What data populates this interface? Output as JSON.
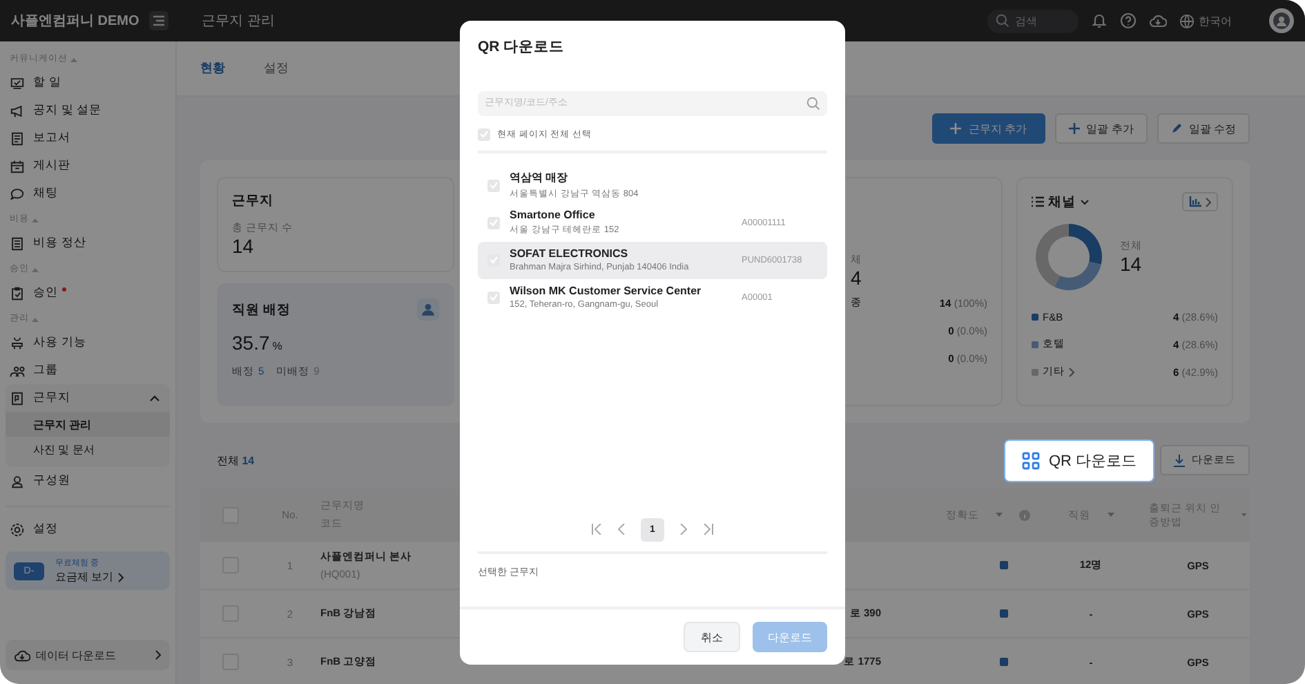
{
  "topbar": {
    "brand": "사플엔컴퍼니 DEMO",
    "page_title": "근무지 관리",
    "search": {
      "placeholder": "검색"
    },
    "language": "한국어"
  },
  "sidebar": {
    "sections": [
      {
        "label": "커뮤니케이션",
        "items": [
          {
            "label": "할 일",
            "alert": false
          },
          {
            "label": "공지 및 설문",
            "alert": false
          },
          {
            "label": "보고서",
            "alert": false
          },
          {
            "label": "게시판",
            "alert": false
          },
          {
            "label": "채팅",
            "alert": false
          }
        ]
      },
      {
        "label": "비용",
        "items": [
          {
            "label": "비용 정산",
            "alert": false
          }
        ]
      },
      {
        "label": "승인",
        "items": [
          {
            "label": "승인",
            "alert": true
          }
        ]
      },
      {
        "label": "관리",
        "items": [
          {
            "label": "사용 기능",
            "alert": false
          },
          {
            "label": "그룹",
            "alert": false
          },
          {
            "label": "근무지",
            "alert": false,
            "expanded": true,
            "children": [
              {
                "label": "근무지 관리",
                "selected": true
              },
              {
                "label": "사진 및 문서",
                "selected": false
              }
            ]
          },
          {
            "label": "구성원",
            "alert": false
          }
        ]
      }
    ],
    "settings": "설정",
    "trial": {
      "badge": "D-",
      "status": "무료체험 중",
      "link": "요금제 보기"
    },
    "data_download": "데이터 다운로드"
  },
  "tabs": [
    {
      "label": "현황",
      "selected": true
    },
    {
      "label": "설정",
      "selected": false
    }
  ],
  "actions": [
    {
      "label": "근무지 추가",
      "kind": "primary"
    },
    {
      "label": "일괄 추가",
      "kind": "add"
    },
    {
      "label": "일괄 수정",
      "kind": "edit"
    }
  ],
  "site_card": {
    "title": "근무지",
    "label": "총 근무지 수",
    "value": "14"
  },
  "staff_card": {
    "title": "직원 배정",
    "value": "35.7",
    "unit": "%",
    "assigned_label": "배정",
    "assigned": "5",
    "unassigned_label": "미배정",
    "unassigned": "9"
  },
  "middle_card": {
    "label": "체",
    "value": "4",
    "rows": [
      {
        "label": "종",
        "count": "14",
        "pct": "(100%)"
      },
      {
        "count": "0",
        "pct": "(0.0%)"
      },
      {
        "count": "0",
        "pct": "(0.0%)"
      }
    ]
  },
  "channel_card": {
    "total_label": "전체",
    "total": "14",
    "legend": [
      {
        "count": "4",
        "pct": "(28.6%)",
        "color": "#1a3d64",
        "more": false
      },
      {
        "count": "4",
        "pct": "(28.6%)",
        "color": "#465b76",
        "more": false
      },
      {
        "count": "6",
        "pct": "(42.9%)",
        "color": "#686868",
        "more": true
      }
    ],
    "chart_data": {
      "type": "donut",
      "title": "채널",
      "categories": [
        "F&B",
        "호텔",
        "기타"
      ],
      "values": [
        28.6,
        28.6,
        42.9
      ]
    }
  },
  "list": {
    "total_label": "전체",
    "total": "14",
    "qr_button": "QR 다운로드",
    "download_button": "다운로드",
    "header_checked": false,
    "columns": [
      "No.",
      "근무지명",
      "코드",
      "정확도",
      "직원",
      "출퇴근 위치 인증방법"
    ],
    "rows": [
      {
        "checked": false,
        "no": "1",
        "name": "사플엔컴퍼니 본사",
        "code": "(HQ001)",
        "staff": "12명",
        "method": "GPS"
      },
      {
        "checked": false,
        "no": "2",
        "name": "FnB 강남점",
        "address": "로 390",
        "staff": "-",
        "method": "GPS"
      },
      {
        "checked": false,
        "no": "3",
        "name": "FnB 고양점",
        "address": "로 1775",
        "staff": "-",
        "method": "GPS"
      }
    ]
  },
  "modal": {
    "title": "QR 다운로드",
    "search": {
      "placeholder": "근무지명/코드/주소"
    },
    "select_all": {
      "label": "현재 페이지 전체 선택",
      "checked": false
    },
    "items": [
      {
        "name": "역삼역 매장",
        "address": "서울특별시 강남구 역삼동 804",
        "checked": false,
        "hovered": false
      },
      {
        "name": "Smartone Office",
        "address": "서울 강남구 테헤란로 152",
        "code": "A00001111",
        "checked": false,
        "hovered": false
      },
      {
        "name": "SOFAT ELECTRONICS",
        "address": "Brahman Majra Sirhind, Punjab 140406 India",
        "code": "PUND6001738",
        "checked": false,
        "hovered": true
      },
      {
        "name": "Wilson MK Customer Service Center",
        "address": "152, Teheran-ro, Gangnam-gu, Seoul",
        "code": "A00001",
        "checked": false,
        "hovered": false
      }
    ],
    "pages": [
      {
        "label": "1",
        "selected": true
      }
    ],
    "selected_label": "선택한 근무지",
    "buttons": [
      {
        "label": "취소",
        "kind": "cancel",
        "disabled": false
      },
      {
        "label": "다운로드",
        "kind": "confirm",
        "disabled": true
      }
    ]
  }
}
